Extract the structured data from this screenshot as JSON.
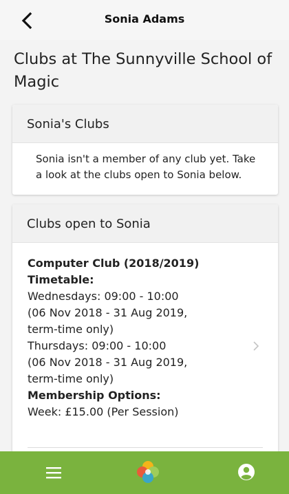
{
  "header": {
    "title": "Sonia Adams",
    "back_icon": "chevron-left-icon"
  },
  "page": {
    "title": "Clubs at The Sunnyville School of Magic"
  },
  "member_clubs": {
    "heading": "Sonia's Clubs",
    "empty_message": "Sonia isn't a member of any club yet. Take a look at the clubs open to Sonia below."
  },
  "open_clubs": {
    "heading": "Clubs open to Sonia",
    "items": [
      {
        "name": "Computer Club (2018/2019)",
        "timetable_label": "Timetable:",
        "sessions": [
          "Wednesdays: 09:00 - 10:00",
          "(06 Nov 2018 - 31 Aug 2019,",
          "term-time only)",
          "Thursdays: 09:00 - 10:00",
          "(06 Nov 2018 - 31 Aug 2019,",
          "term-time only)"
        ],
        "membership_label": "Membership Options:",
        "membership_option": "Week: £15.00 (Per Session)"
      }
    ]
  },
  "footer": {
    "menu_icon": "menu-icon",
    "logo_icon": "logo-icon",
    "user_icon": "user-icon"
  },
  "colors": {
    "footer_background": "#7ab33e",
    "page_background": "#f3f3f3",
    "card_header_background": "#f1f1f1"
  }
}
